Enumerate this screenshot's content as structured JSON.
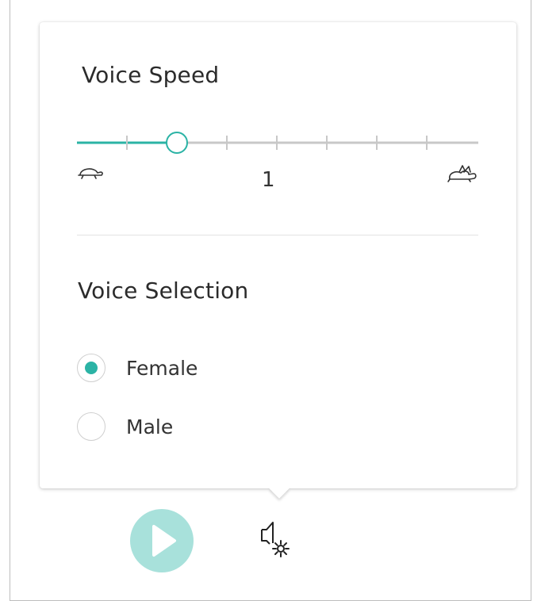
{
  "voice_speed": {
    "title": "Voice Speed",
    "value_label": "1",
    "slider": {
      "tick_count": 8,
      "selected_index": 2,
      "accent_color": "#2bb3a5",
      "track_color": "#c8c8c8"
    },
    "slow_icon": "turtle-icon",
    "fast_icon": "rabbit-icon"
  },
  "voice_selection": {
    "title": "Voice Selection",
    "options": [
      {
        "label": "Female",
        "selected": true
      },
      {
        "label": "Male",
        "selected": false
      }
    ]
  },
  "toolbar": {
    "play_icon": "play-icon",
    "play_color": "#a8e1db",
    "settings_icon": "voice-settings-icon"
  }
}
